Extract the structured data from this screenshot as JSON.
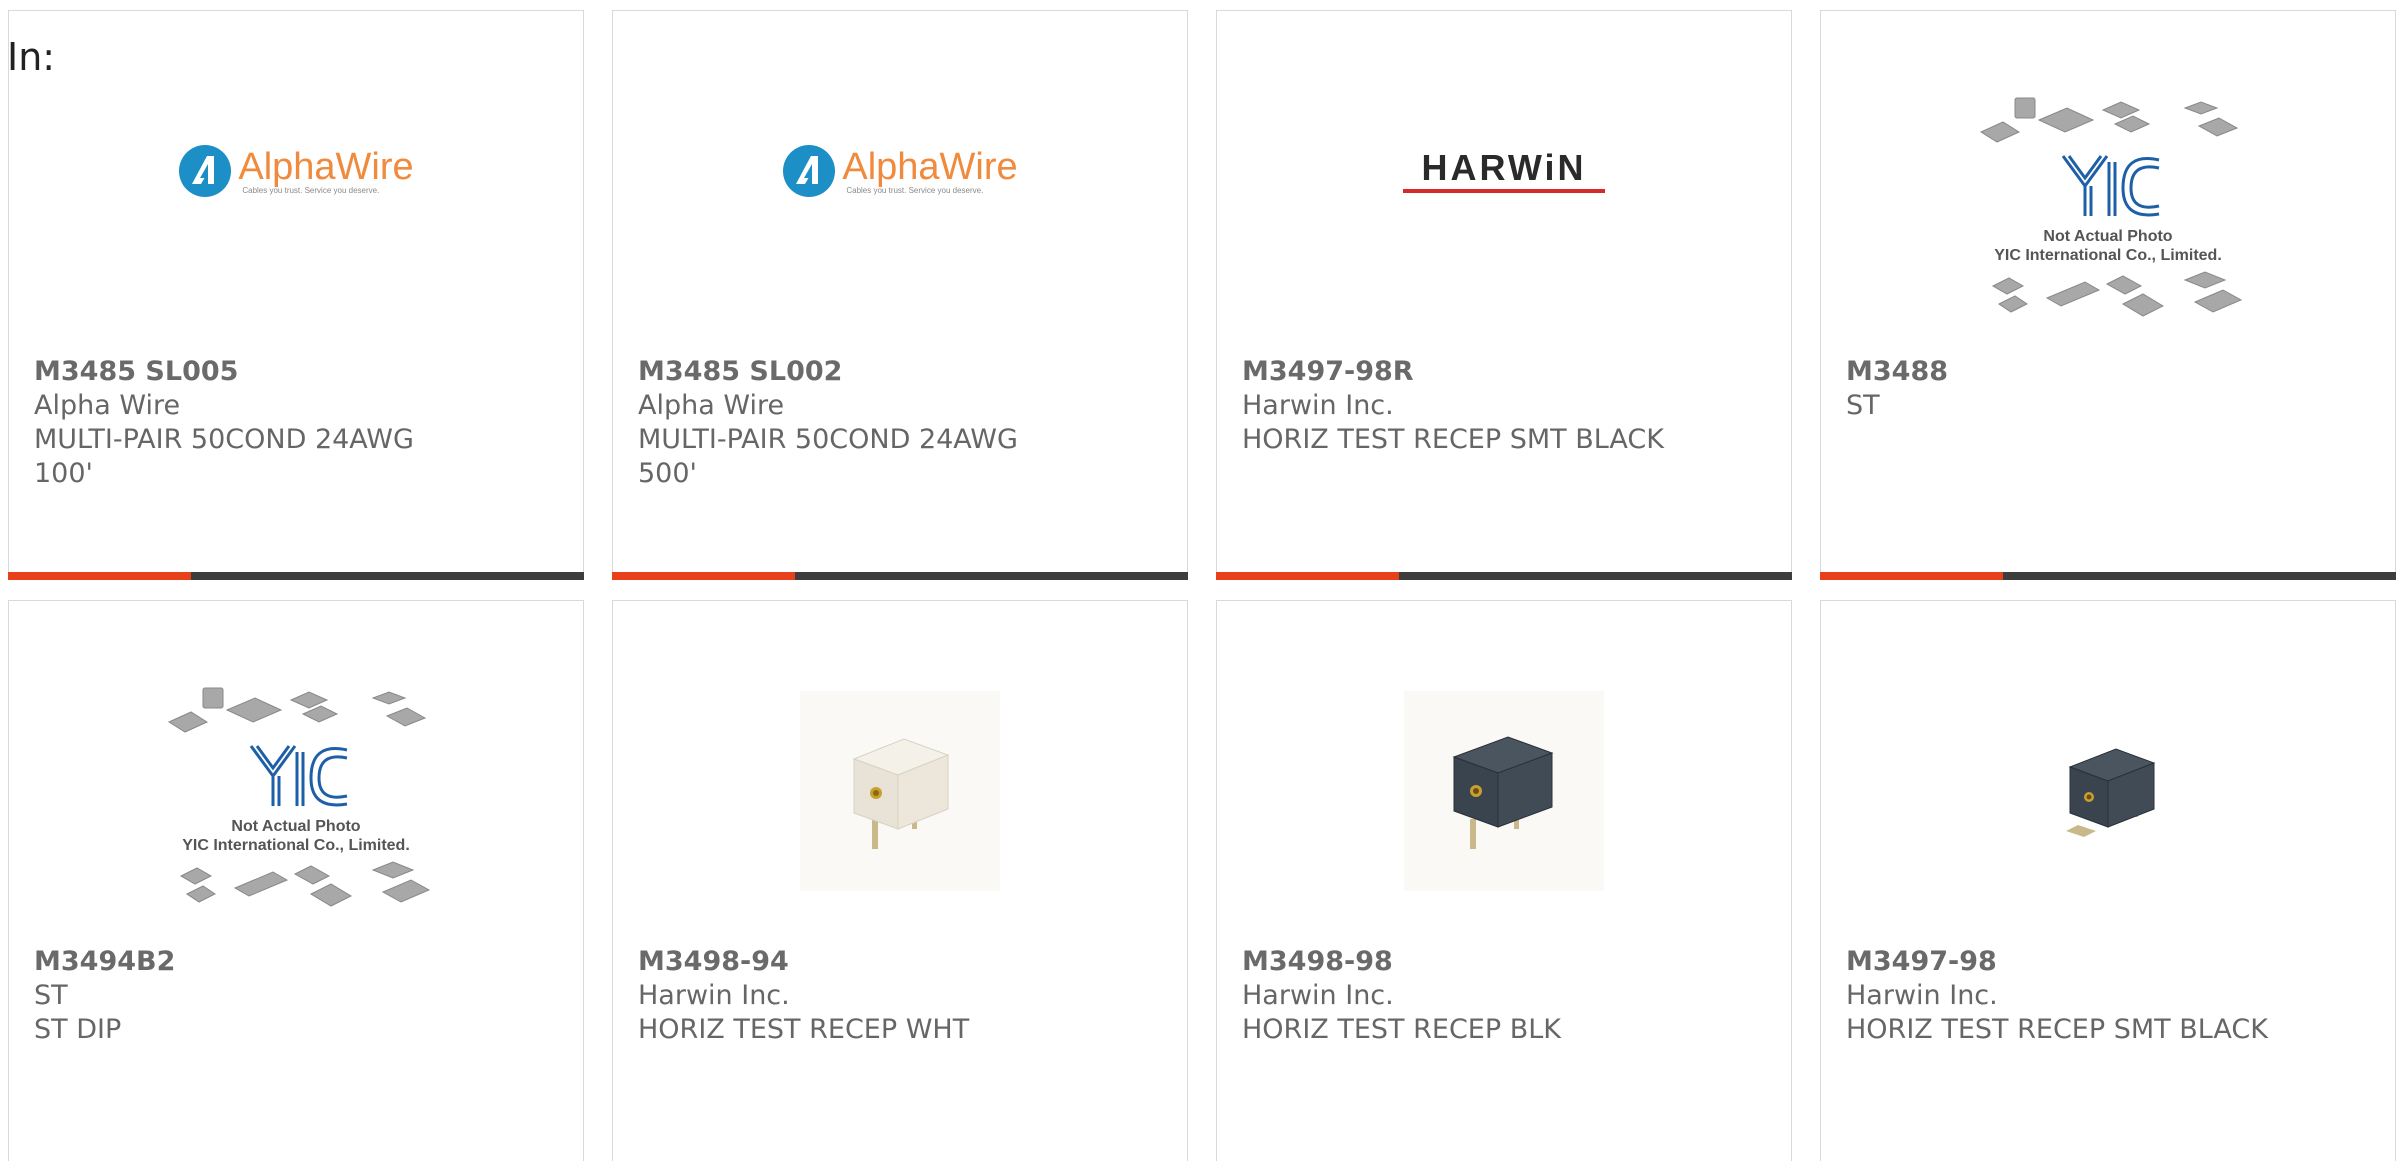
{
  "header": {
    "in_label": "In:"
  },
  "colors": {
    "accent": "#e8401a",
    "bar": "#3d3d3d",
    "text": "#666666"
  },
  "logos": {
    "alphawire": {
      "name": "AlphaWire",
      "tagline": "Cables you trust. Service you deserve."
    },
    "harwin": {
      "name": "HARWiN"
    },
    "yic": {
      "caption_line1": "Not Actual Photo",
      "caption_line2": "YIC International Co., Limited."
    }
  },
  "products": [
    {
      "part_number": "M3485 SL005",
      "manufacturer": "Alpha Wire",
      "description": "MULTI-PAIR 50COND 24AWG",
      "description2": "100'",
      "image": "alphawire-logo"
    },
    {
      "part_number": "M3485 SL002",
      "manufacturer": "Alpha Wire",
      "description": "MULTI-PAIR 50COND 24AWG",
      "description2": "500'",
      "image": "alphawire-logo"
    },
    {
      "part_number": "M3497-98R",
      "manufacturer": "Harwin Inc.",
      "description": "HORIZ TEST RECEP SMT BLACK",
      "description2": "",
      "image": "harwin-logo"
    },
    {
      "part_number": "M3488",
      "manufacturer": "ST",
      "description": "",
      "description2": "",
      "image": "yic-placeholder"
    },
    {
      "part_number": "M3494B2",
      "manufacturer": "ST",
      "description": "ST DIP",
      "description2": "",
      "image": "yic-placeholder"
    },
    {
      "part_number": "M3498-94",
      "manufacturer": "Harwin Inc.",
      "description": "HORIZ TEST RECEP WHT",
      "description2": "",
      "image": "white-test-receptacle"
    },
    {
      "part_number": "M3498-98",
      "manufacturer": "Harwin Inc.",
      "description": "HORIZ TEST RECEP BLK",
      "description2": "",
      "image": "black-test-receptacle"
    },
    {
      "part_number": "M3497-98",
      "manufacturer": "Harwin Inc.",
      "description": "HORIZ TEST RECEP SMT BLACK",
      "description2": "",
      "image": "black-smt-test-receptacle"
    }
  ]
}
